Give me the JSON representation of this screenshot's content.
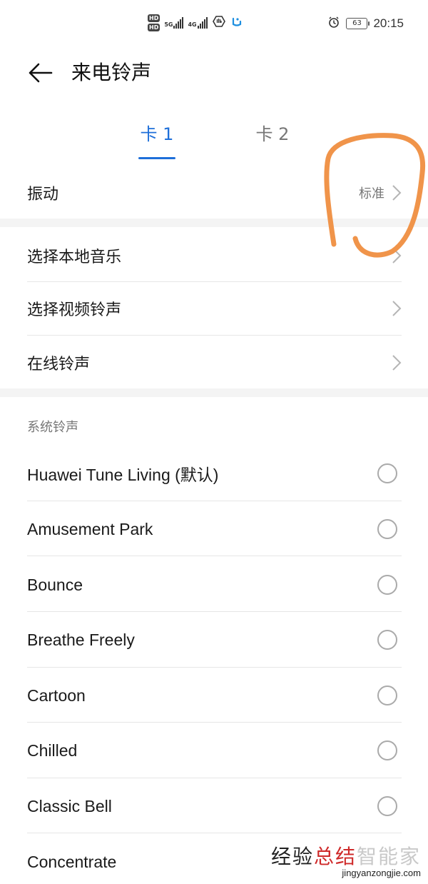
{
  "status_bar": {
    "hd1": "HD",
    "hd2": "HD",
    "net1": "5G",
    "net2": "4G",
    "battery": "63",
    "time": "20:15"
  },
  "header": {
    "title": "来电铃声"
  },
  "tabs": [
    {
      "label": "卡 1",
      "selected": true
    },
    {
      "label": "卡 2",
      "selected": false
    }
  ],
  "vibration": {
    "label": "振动",
    "value": "标准"
  },
  "options": [
    {
      "label": "选择本地音乐"
    },
    {
      "label": "选择视频铃声"
    },
    {
      "label": "在线铃声"
    }
  ],
  "system_ringtones": {
    "title": "系统铃声",
    "items": [
      {
        "label": "Huawei Tune Living (默认)"
      },
      {
        "label": "Amusement Park"
      },
      {
        "label": "Bounce"
      },
      {
        "label": "Breathe Freely"
      },
      {
        "label": "Cartoon"
      },
      {
        "label": "Chilled"
      },
      {
        "label": "Classic Bell"
      },
      {
        "label": "Concentrate"
      }
    ]
  },
  "watermark": {
    "line1_a": "经验",
    "line1_b": "总结",
    "line1_faint": "智能家",
    "line2": "jingyanzongjie.com"
  },
  "colors": {
    "accent": "#1e6fd9",
    "annotation": "#f0944a"
  }
}
